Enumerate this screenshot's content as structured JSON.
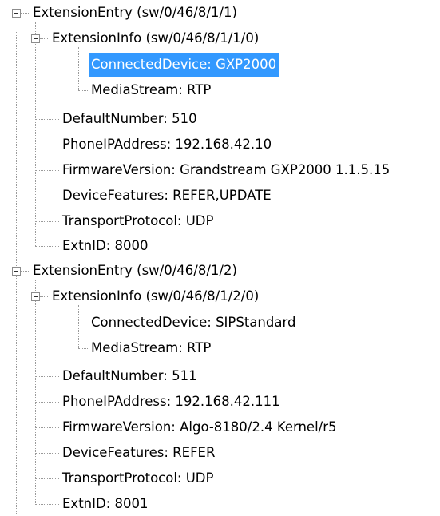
{
  "tree": {
    "entry1": {
      "label": "ExtensionEntry (sw/0/46/8/1/1)",
      "info": {
        "label": "ExtensionInfo (sw/0/46/8/1/1/0)",
        "children": [
          "ConnectedDevice: GXP2000",
          "MediaStream: RTP"
        ]
      },
      "fields": [
        "DefaultNumber: 510",
        "PhoneIPAddress: 192.168.42.10",
        "FirmwareVersion: Grandstream GXP2000 1.1.5.15",
        "DeviceFeatures: REFER,UPDATE",
        "TransportProtocol: UDP",
        "ExtnID: 8000"
      ]
    },
    "entry2": {
      "label": "ExtensionEntry (sw/0/46/8/1/2)",
      "info": {
        "label": "ExtensionInfo (sw/0/46/8/1/2/0)",
        "children": [
          "ConnectedDevice: SIPStandard",
          "MediaStream: RTP"
        ]
      },
      "fields": [
        "DefaultNumber: 511",
        "PhoneIPAddress: 192.168.42.111",
        "FirmwareVersion: Algo-8180/2.4 Kernel/r5",
        "DeviceFeatures: REFER",
        "TransportProtocol: UDP",
        "ExtnID: 8001"
      ]
    },
    "selected": "ConnectedDevice: GXP2000",
    "colors": {
      "selection_bg": "#3399ff",
      "selection_text": "#ffffff",
      "connector": "#9a9a9a"
    }
  }
}
